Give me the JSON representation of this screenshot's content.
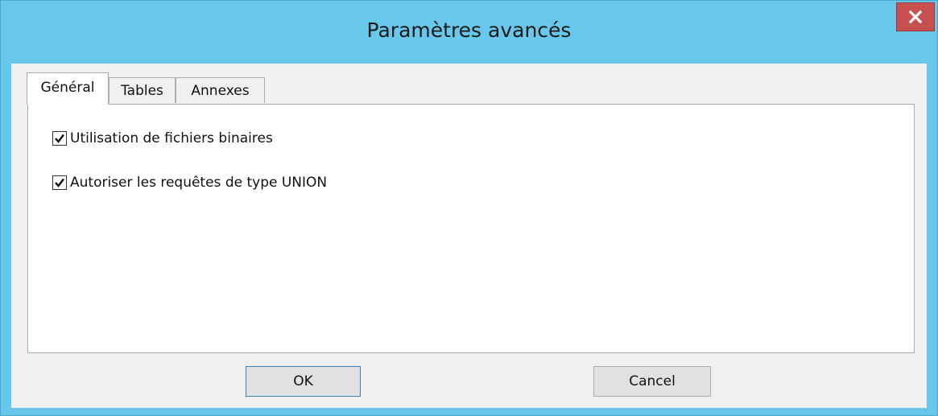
{
  "window": {
    "title": "Paramètres avancés",
    "close_icon": "close-icon"
  },
  "tabs": [
    {
      "label": "Général",
      "active": true
    },
    {
      "label": "Tables",
      "active": false
    },
    {
      "label": "Annexes",
      "active": false
    }
  ],
  "general": {
    "options": [
      {
        "label": "Utilisation de fichiers binaires",
        "checked": true
      },
      {
        "label": "Autoriser les requêtes de type UNION",
        "checked": true
      }
    ]
  },
  "buttons": {
    "ok_label": "OK",
    "cancel_label": "Cancel"
  },
  "colors": {
    "titlebar": "#67c8ec",
    "close_button": "#c75050",
    "dialog_face": "#f0f0f0"
  }
}
